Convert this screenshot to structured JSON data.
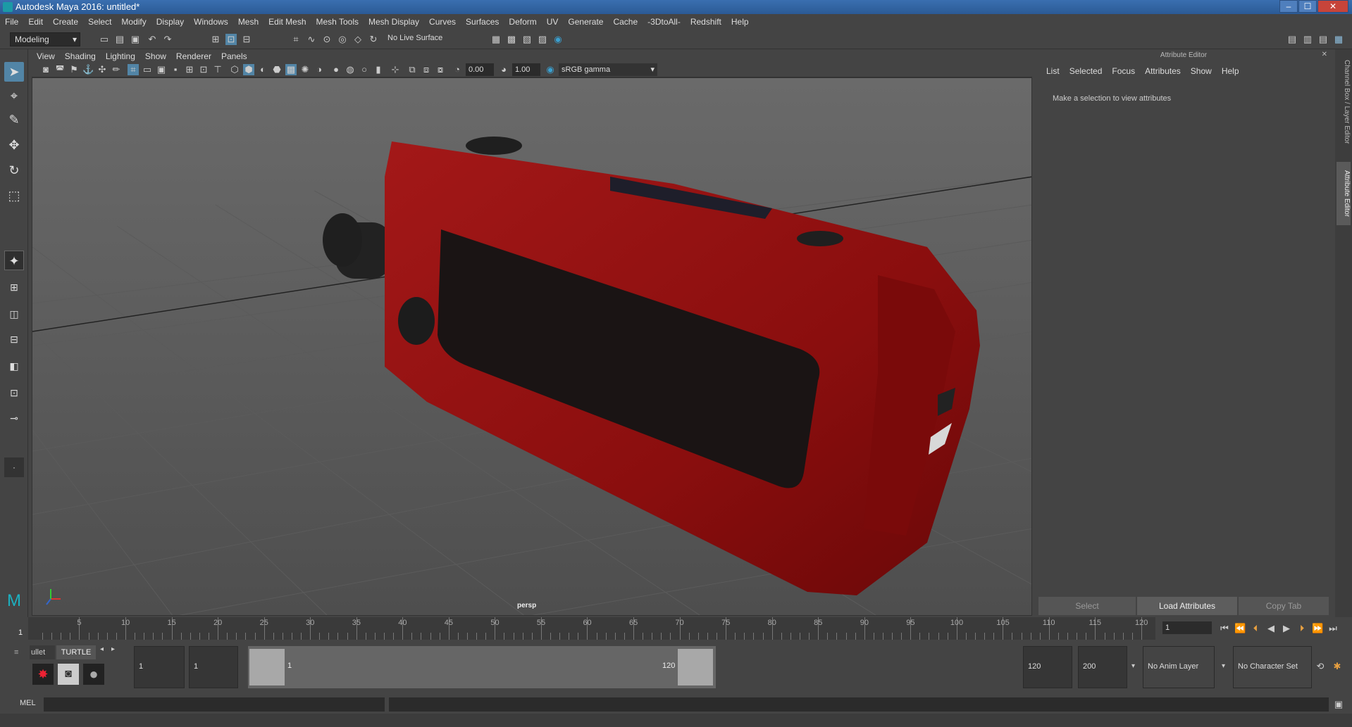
{
  "window": {
    "title": "Autodesk Maya 2016: untitled*",
    "min": "‒",
    "max": "☐",
    "close": "✕"
  },
  "menu": [
    "File",
    "Edit",
    "Create",
    "Select",
    "Modify",
    "Display",
    "Windows",
    "Mesh",
    "Edit Mesh",
    "Mesh Tools",
    "Mesh Display",
    "Curves",
    "Surfaces",
    "Deform",
    "UV",
    "Generate",
    "Cache",
    "-3DtoAll-",
    "Redshift",
    "Help"
  ],
  "status": {
    "menuset": "Modeling",
    "live_surface": "No Live Surface"
  },
  "panel_menu": [
    "View",
    "Shading",
    "Lighting",
    "Show",
    "Renderer",
    "Panels"
  ],
  "panel_tools": {
    "exposure": "0.00",
    "gamma": "1.00",
    "colorspace": "sRGB gamma"
  },
  "viewport": {
    "camera_label": "persp"
  },
  "attribute_editor": {
    "title": "Attribute Editor",
    "menu": [
      "List",
      "Selected",
      "Focus",
      "Attributes",
      "Show",
      "Help"
    ],
    "message": "Make a selection to view attributes",
    "buttons": {
      "select": "Select",
      "load": "Load Attributes",
      "copy": "Copy Tab"
    }
  },
  "side_tabs": {
    "channel": "Channel Box / Layer Editor",
    "attr": "Attribute Editor"
  },
  "timeline": {
    "ticks": [
      "5",
      "10",
      "15",
      "20",
      "25",
      "30",
      "35",
      "40",
      "45",
      "50",
      "55",
      "60",
      "65",
      "70",
      "75",
      "80",
      "85",
      "90",
      "95",
      "100",
      "105",
      "110",
      "115",
      "120"
    ],
    "start_label": "1",
    "current_frame": "1"
  },
  "range": {
    "shelf_tabs": [
      "ullet",
      "TURTLE"
    ],
    "start": "1",
    "anim_start": "1",
    "range_start_lbl": "1",
    "range_end_lbl": "120",
    "anim_end": "120",
    "end": "200",
    "anim_layer": "No Anim Layer",
    "char_set": "No Character Set"
  },
  "cmd": {
    "lang": "MEL"
  }
}
